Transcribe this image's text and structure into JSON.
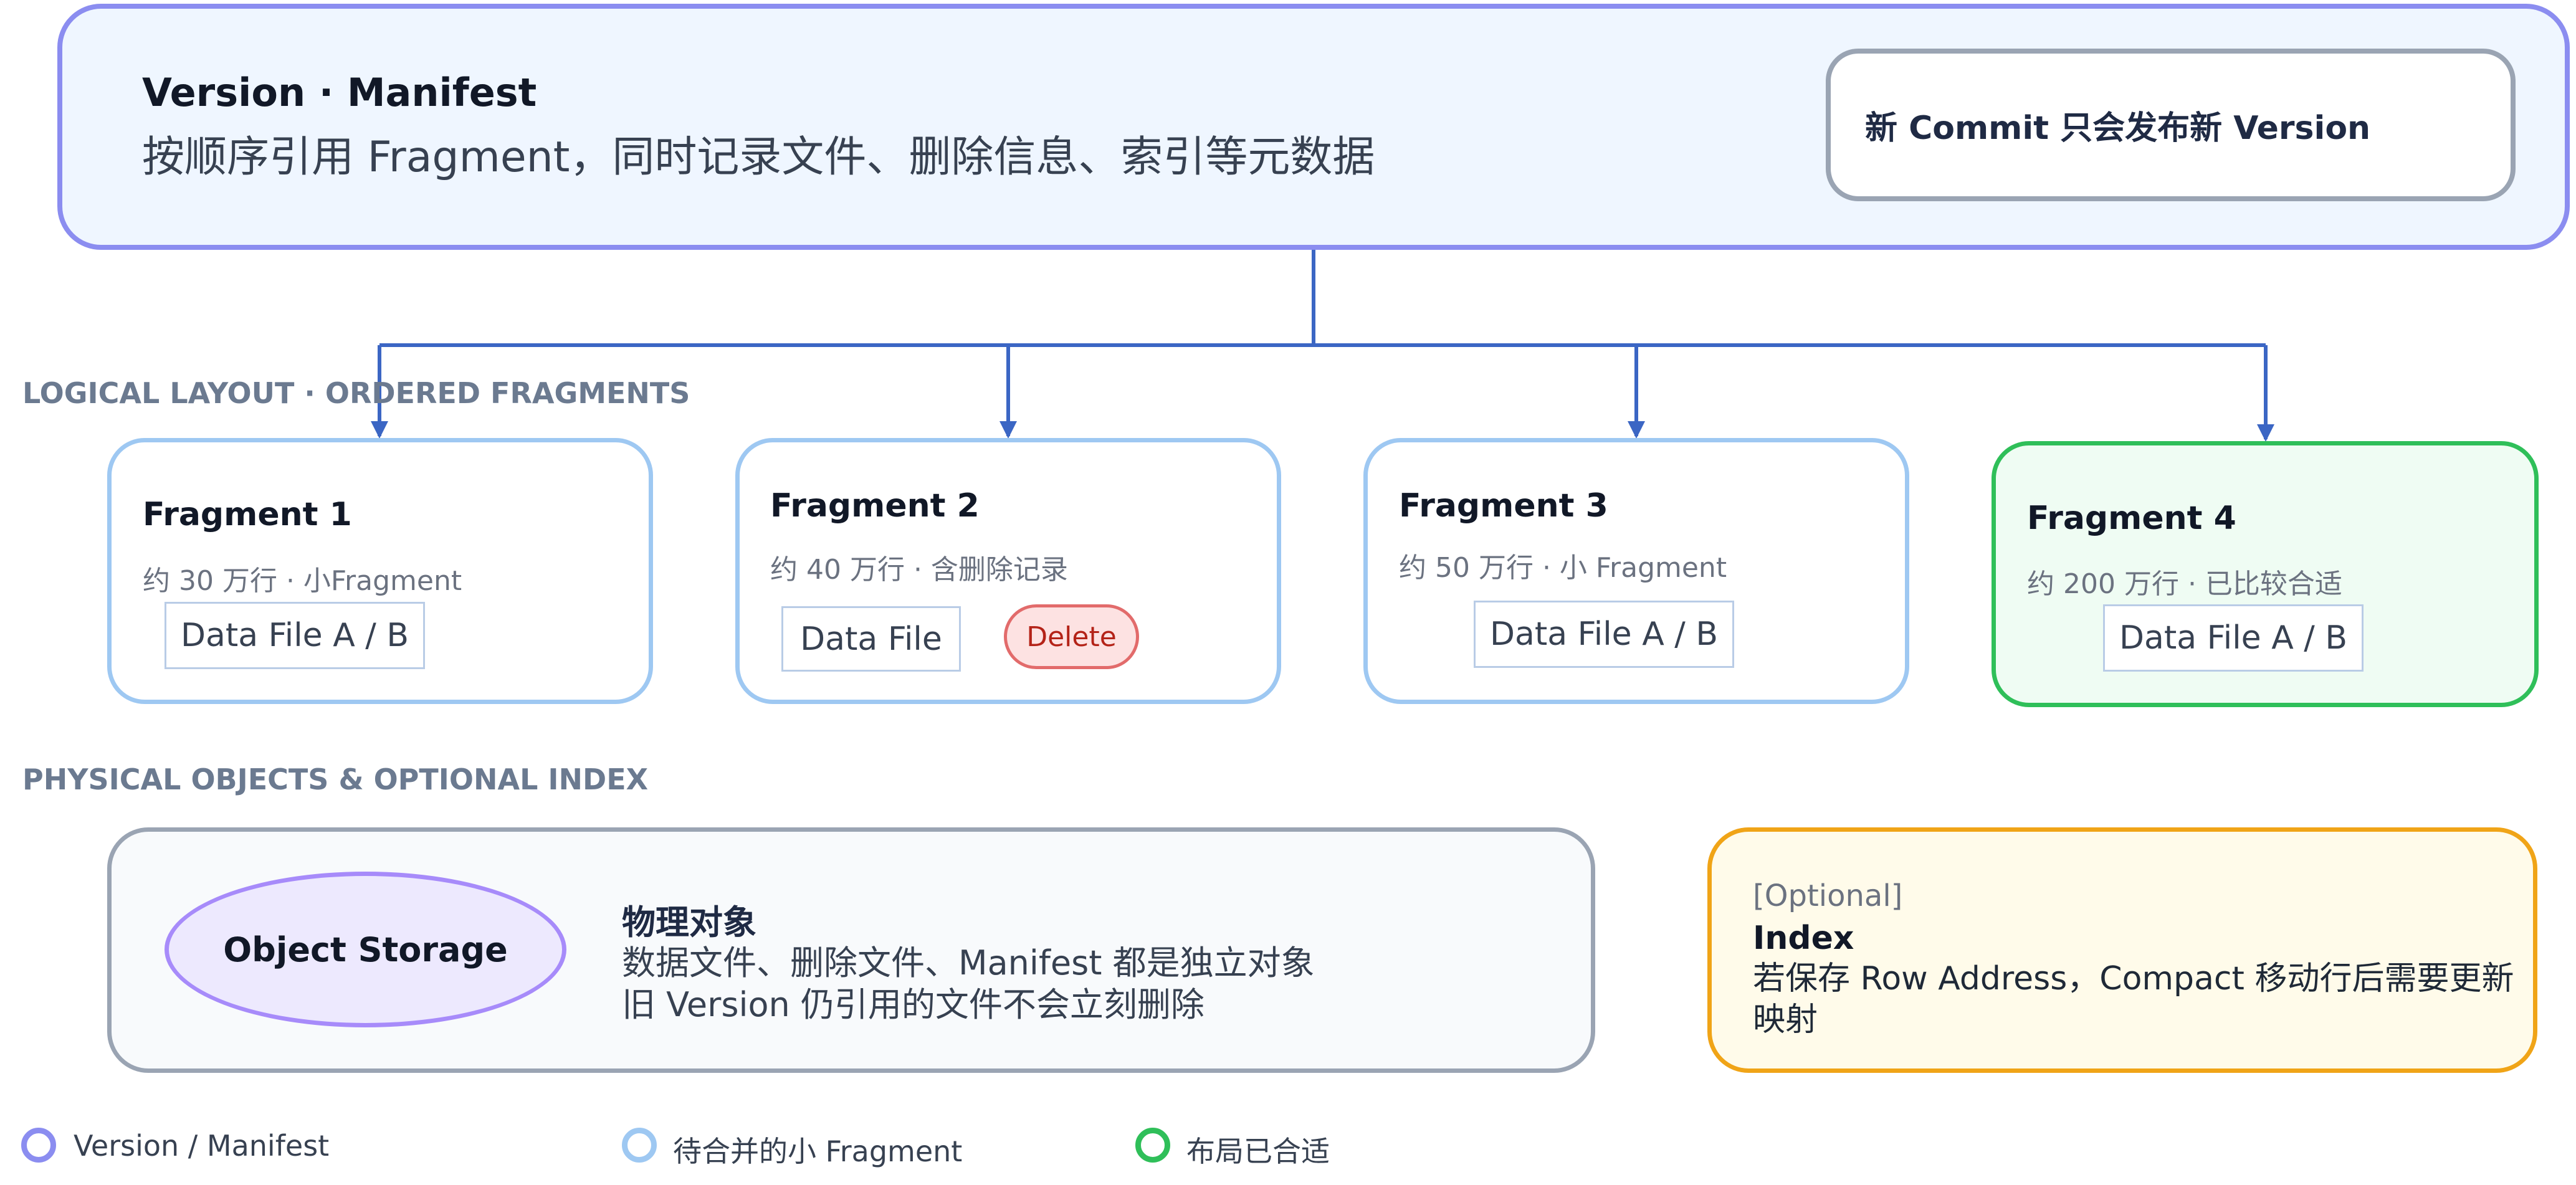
{
  "version": {
    "title": "Version · Manifest",
    "subtitle": "按顺序引用 Fragment，同时记录文件、删除信息、索引等元数据",
    "commit_note": "新 Commit 只会发布新 Version"
  },
  "sections": {
    "logical": "LOGICAL LAYOUT · ORDERED FRAGMENTS",
    "physical": "PHYSICAL OBJECTS & OPTIONAL INDEX"
  },
  "fragments": [
    {
      "title": "Fragment 1",
      "meta": "约 30 万行 · 小Fragment",
      "file": "Data File A / B"
    },
    {
      "title": "Fragment 2",
      "meta": "约 40 万行 · 含删除记录",
      "file": "Data File",
      "delete": "Delete"
    },
    {
      "title": "Fragment 3",
      "meta": "约 50 万行 · 小 Fragment",
      "file": "Data File A / B"
    },
    {
      "title": "Fragment 4",
      "meta": "约 200 万行 · 已比较合适",
      "file": "Data File A / B"
    }
  ],
  "physical": {
    "storage_label": "Object Storage",
    "title": "物理对象",
    "line1": "数据文件、删除文件、Manifest 都是独立对象",
    "line2": "旧 Version 仍引用的文件不会立刻删除"
  },
  "index": {
    "tag": "[Optional]",
    "title": "Index",
    "desc": "若保存 Row Address，Compact 移动行后需要更新映射"
  },
  "legend": [
    {
      "label": "Version / Manifest",
      "color": "#8b8df0"
    },
    {
      "label": "待合并的小 Fragment",
      "color": "#9ec8f2"
    },
    {
      "label": "布局已合适",
      "color": "#2fbf59"
    }
  ],
  "colors": {
    "connector": "#3b66c4",
    "version_border": "#8b8df0",
    "fragment_border": "#9ec8f2",
    "good_border": "#2fbf59",
    "delete_border": "#e26b6b",
    "index_border": "#f0a417",
    "storage_border": "#a78bfa"
  }
}
